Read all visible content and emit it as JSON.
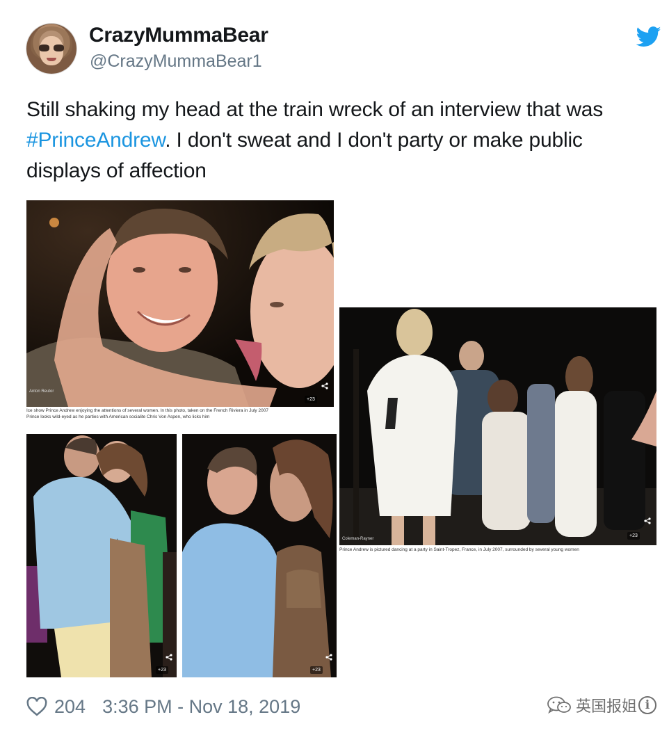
{
  "user": {
    "display_name": "CrazyMummaBear",
    "handle": "@CrazyMummaBear1"
  },
  "tweet": {
    "text_before": "Still shaking my head at the train wreck of an interview that was ",
    "hashtag": "#PrinceAndrew",
    "text_after": ". I don't sweat and I don't party or make public displays of affection"
  },
  "media": {
    "collage_top_left": {
      "credit": "Anton Reutor",
      "caption_line_1": "Ice show Prince Andrew enjoying the attentions of several women. In this photo, taken on the French Riviera in July 2007",
      "caption_line_2": "Prince looks wild-eyed as he parties with American socialite Chris Von Aspen, who licks him",
      "count": "+23"
    },
    "collage_right": {
      "credit": "Coleman-Rayner",
      "caption": "Prince Andrew is pictured dancing at a party in Saint-Tropez, France, in July 2007, surrounded by several young women",
      "count": "+23"
    },
    "collage_bottom_left": {
      "count": "+23"
    },
    "collage_bottom_mid": {
      "count": "+23"
    }
  },
  "footer": {
    "likes": "204",
    "timestamp": "3:36 PM - Nov 18, 2019"
  },
  "watermark": {
    "text": "英国报姐"
  },
  "colors": {
    "hashtag": "#1b95e0",
    "twitter_blue": "#1da1f2",
    "meta_gray": "#657786"
  },
  "icons": [
    "twitter-bird-icon",
    "heart-icon",
    "wechat-icon",
    "info-icon",
    "share-icon"
  ]
}
